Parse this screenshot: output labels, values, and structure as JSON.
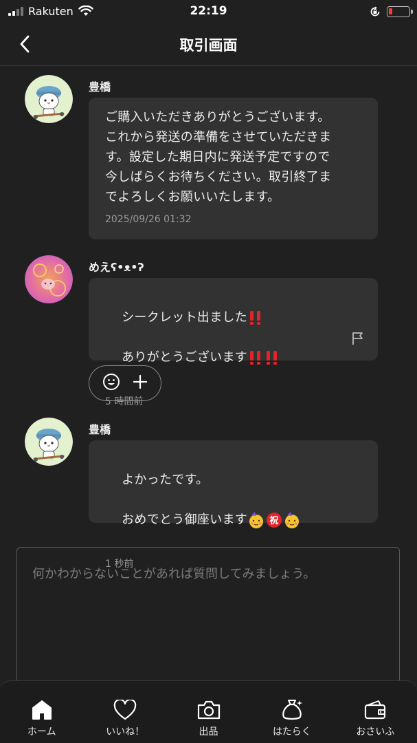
{
  "status_bar": {
    "carrier": "Rakuten",
    "time": "22:19",
    "battery_level": 0.1,
    "battery_color": "#ff3b30"
  },
  "nav": {
    "title": "取引画面",
    "back_icon": "chevron-left-icon"
  },
  "messages": [
    {
      "sender": "豊橋",
      "avatar": "avatar-penguin-scooter",
      "text": "ご購入いただきありがとうございます。\nこれから発送の準備をさせていただきま\nす。設定した期日内に発送予定ですので\n今しばらくお待ちください。取引終了ま\nでよろしくお願いいたします。",
      "time": "2025/09/26 01:32"
    },
    {
      "sender": "めえʕ•ᴥ•ʔ",
      "avatar": "avatar-pink-patterned",
      "text_line1": "シークレット出ました",
      "text_line2": "ありがとうございます",
      "time": "5 時間前",
      "flag_icon": "flag-icon"
    },
    {
      "sender": "豊橋",
      "avatar": "avatar-penguin-scooter",
      "text_line1": "よかったです。",
      "text_line2": "おめでとう御座います",
      "time": "1 秒前"
    }
  ],
  "reaction": {
    "emoji_icon": "smiley-icon",
    "add_icon": "plus-icon"
  },
  "compose": {
    "placeholder": "何かわからないことがあれば質問してみましょう。"
  },
  "tabs": [
    {
      "label": "ホーム",
      "icon": "home-icon"
    },
    {
      "label": "いいね！",
      "icon": "heart-icon"
    },
    {
      "label": "出品",
      "icon": "camera-icon"
    },
    {
      "label": "はたらく",
      "icon": "money-bag-icon"
    },
    {
      "label": "おさいふ",
      "icon": "wallet-icon"
    }
  ],
  "colors": {
    "background": "#202020",
    "bubble": "#323232",
    "accent_red": "#e0242a"
  }
}
